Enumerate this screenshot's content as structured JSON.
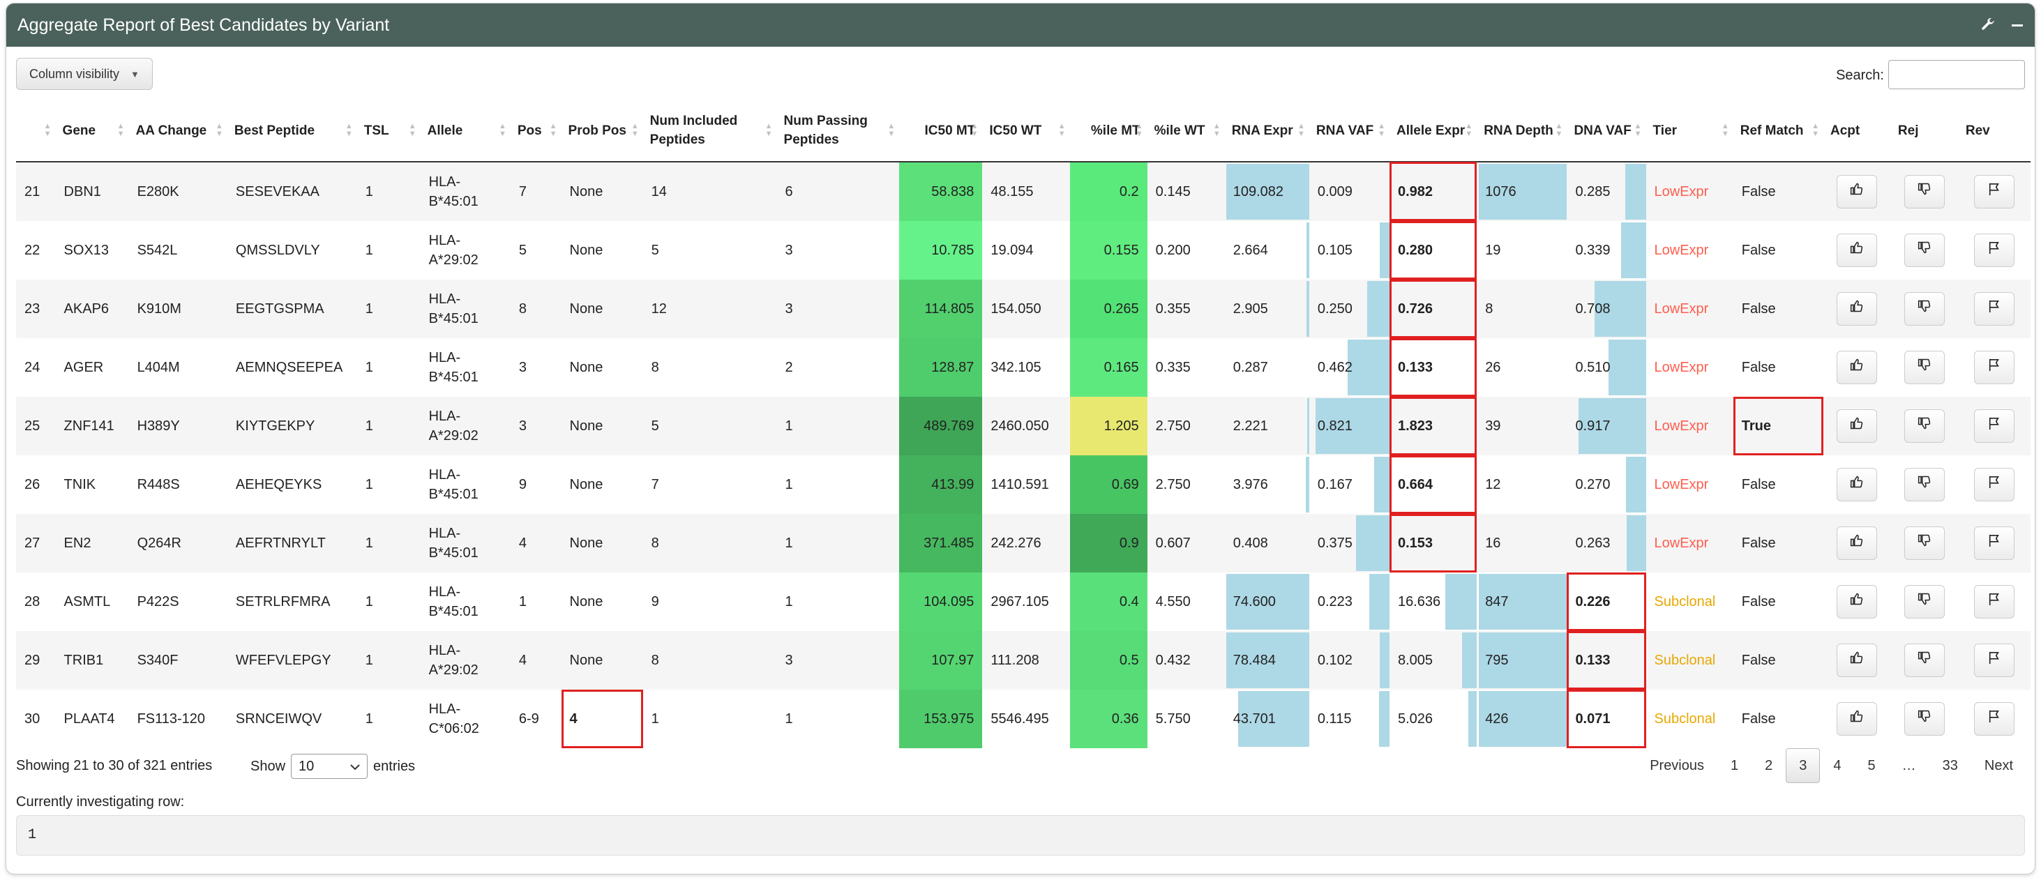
{
  "title": "Aggregate Report of Best Candidates by Variant",
  "toolbar": {
    "column_visibility": "Column visibility",
    "search_label": "Search:"
  },
  "columns": [
    {
      "key": "id",
      "label": ""
    },
    {
      "key": "gene",
      "label": "Gene"
    },
    {
      "key": "aa",
      "label": "AA Change"
    },
    {
      "key": "pep",
      "label": "Best Peptide"
    },
    {
      "key": "tsl",
      "label": "TSL"
    },
    {
      "key": "allele",
      "label": "Allele"
    },
    {
      "key": "pos",
      "label": "Pos"
    },
    {
      "key": "ppos",
      "label": "Prob Pos"
    },
    {
      "key": "ninc",
      "label": "Num Included Peptides"
    },
    {
      "key": "npass",
      "label": "Num Passing Peptides"
    },
    {
      "key": "ic50mt",
      "label": "IC50 MT"
    },
    {
      "key": "ic50wt",
      "label": "IC50 WT"
    },
    {
      "key": "pmt",
      "label": "%ile MT"
    },
    {
      "key": "pwt",
      "label": "%ile WT"
    },
    {
      "key": "rexpr",
      "label": "RNA Expr"
    },
    {
      "key": "rvaf",
      "label": "RNA VAF"
    },
    {
      "key": "aexpr",
      "label": "Allele Expr"
    },
    {
      "key": "rdepth",
      "label": "RNA Depth"
    },
    {
      "key": "dvaf",
      "label": "DNA VAF"
    },
    {
      "key": "tier",
      "label": "Tier"
    },
    {
      "key": "ref",
      "label": "Ref Match"
    },
    {
      "key": "acpt",
      "label": "Acpt"
    },
    {
      "key": "rej",
      "label": "Rej"
    },
    {
      "key": "rev",
      "label": "Rev"
    }
  ],
  "rows": [
    {
      "id": "21",
      "gene": "DBN1",
      "aa": "E280K",
      "pep": "SESEVEKAA",
      "tsl": "1",
      "allele": "HLA-B*45:01",
      "pos": "7",
      "ppos": "None",
      "ninc": "14",
      "npass": "6",
      "ic50mt": "58.838",
      "ic50wt": "48.155",
      "pmt": "0.2",
      "pwt": "0.145",
      "rexpr": "109.082",
      "rvaf": "0.009",
      "aexpr": "0.982",
      "rdepth": "1076",
      "dvaf": "0.285",
      "tier": "LowExpr",
      "ref": "False"
    },
    {
      "id": "22",
      "gene": "SOX13",
      "aa": "S542L",
      "pep": "QMSSLDVLY",
      "tsl": "1",
      "allele": "HLA-A*29:02",
      "pos": "5",
      "ppos": "None",
      "ninc": "5",
      "npass": "3",
      "ic50mt": "10.785",
      "ic50wt": "19.094",
      "pmt": "0.155",
      "pwt": "0.200",
      "rexpr": "2.664",
      "rvaf": "0.105",
      "aexpr": "0.280",
      "rdepth": "19",
      "dvaf": "0.339",
      "tier": "LowExpr",
      "ref": "False"
    },
    {
      "id": "23",
      "gene": "AKAP6",
      "aa": "K910M",
      "pep": "EEGTGSPMA",
      "tsl": "1",
      "allele": "HLA-B*45:01",
      "pos": "8",
      "ppos": "None",
      "ninc": "12",
      "npass": "3",
      "ic50mt": "114.805",
      "ic50wt": "154.050",
      "pmt": "0.265",
      "pwt": "0.355",
      "rexpr": "2.905",
      "rvaf": "0.250",
      "aexpr": "0.726",
      "rdepth": "8",
      "dvaf": "0.708",
      "tier": "LowExpr",
      "ref": "False"
    },
    {
      "id": "24",
      "gene": "AGER",
      "aa": "L404M",
      "pep": "AEMNQSEEPEA",
      "tsl": "1",
      "allele": "HLA-B*45:01",
      "pos": "3",
      "ppos": "None",
      "ninc": "8",
      "npass": "2",
      "ic50mt": "128.87",
      "ic50wt": "342.105",
      "pmt": "0.165",
      "pwt": "0.335",
      "rexpr": "0.287",
      "rvaf": "0.462",
      "aexpr": "0.133",
      "rdepth": "26",
      "dvaf": "0.510",
      "tier": "LowExpr",
      "ref": "False"
    },
    {
      "id": "25",
      "gene": "ZNF141",
      "aa": "H389Y",
      "pep": "KIYTGEKPY",
      "tsl": "1",
      "allele": "HLA-A*29:02",
      "pos": "3",
      "ppos": "None",
      "ninc": "5",
      "npass": "1",
      "ic50mt": "489.769",
      "ic50wt": "2460.050",
      "pmt": "1.205",
      "pwt": "2.750",
      "rexpr": "2.221",
      "rvaf": "0.821",
      "aexpr": "1.823",
      "rdepth": "39",
      "dvaf": "0.917",
      "tier": "LowExpr",
      "ref": "True"
    },
    {
      "id": "26",
      "gene": "TNIK",
      "aa": "R448S",
      "pep": "AEHEQEYKS",
      "tsl": "1",
      "allele": "HLA-B*45:01",
      "pos": "9",
      "ppos": "None",
      "ninc": "7",
      "npass": "1",
      "ic50mt": "413.99",
      "ic50wt": "1410.591",
      "pmt": "0.69",
      "pwt": "2.750",
      "rexpr": "3.976",
      "rvaf": "0.167",
      "aexpr": "0.664",
      "rdepth": "12",
      "dvaf": "0.270",
      "tier": "LowExpr",
      "ref": "False"
    },
    {
      "id": "27",
      "gene": "EN2",
      "aa": "Q264R",
      "pep": "AEFRTNRYLT",
      "tsl": "1",
      "allele": "HLA-B*45:01",
      "pos": "4",
      "ppos": "None",
      "ninc": "8",
      "npass": "1",
      "ic50mt": "371.485",
      "ic50wt": "242.276",
      "pmt": "0.9",
      "pwt": "0.607",
      "rexpr": "0.408",
      "rvaf": "0.375",
      "aexpr": "0.153",
      "rdepth": "16",
      "dvaf": "0.263",
      "tier": "LowExpr",
      "ref": "False"
    },
    {
      "id": "28",
      "gene": "ASMTL",
      "aa": "P422S",
      "pep": "SETRLRFMRA",
      "tsl": "1",
      "allele": "HLA-B*45:01",
      "pos": "1",
      "ppos": "None",
      "ninc": "9",
      "npass": "1",
      "ic50mt": "104.095",
      "ic50wt": "2967.105",
      "pmt": "0.4",
      "pwt": "4.550",
      "rexpr": "74.600",
      "rvaf": "0.223",
      "aexpr": "16.636",
      "rdepth": "847",
      "dvaf": "0.226",
      "tier": "Subclonal",
      "ref": "False"
    },
    {
      "id": "29",
      "gene": "TRIB1",
      "aa": "S340F",
      "pep": "WFEFVLEPGY",
      "tsl": "1",
      "allele": "HLA-A*29:02",
      "pos": "4",
      "ppos": "None",
      "ninc": "8",
      "npass": "3",
      "ic50mt": "107.97",
      "ic50wt": "111.208",
      "pmt": "0.5",
      "pwt": "0.432",
      "rexpr": "78.484",
      "rvaf": "0.102",
      "aexpr": "8.005",
      "rdepth": "795",
      "dvaf": "0.133",
      "tier": "Subclonal",
      "ref": "False"
    },
    {
      "id": "30",
      "gene": "PLAAT4",
      "aa": "FS113-120",
      "pep": "SRNCEIWQV",
      "tsl": "1",
      "allele": "HLA-C*06:02",
      "pos": "6-9",
      "ppos": "4",
      "ninc": "1",
      "npass": "1",
      "ic50mt": "153.975",
      "ic50wt": "5546.495",
      "pmt": "0.36",
      "pwt": "5.750",
      "rexpr": "43.701",
      "rvaf": "0.115",
      "aexpr": "5.026",
      "rdepth": "426",
      "dvaf": "0.071",
      "tier": "Subclonal",
      "ref": "False"
    }
  ],
  "styling": {
    "ic50_colors": [
      "#5ce07a",
      "#66f28a",
      "#52d06e",
      "#4fcd6c",
      "#3ea656",
      "#44b25c",
      "#46b85f",
      "#55d873",
      "#54d571",
      "#4fcb6b"
    ],
    "pct_colors": [
      "#5aea7c",
      "#60ed80",
      "#52e275",
      "#5ee97f",
      "#e8e870",
      "#48c563",
      "#3fa958",
      "#5ae07a",
      "#57dc77",
      "#5ce07b"
    ],
    "rexpr_fill": [
      0.98,
      0.03,
      0.03,
      0.0,
      0.02,
      0.04,
      0.0,
      0.98,
      0.98,
      0.84
    ],
    "rvaf_fill": [
      0.0,
      0.12,
      0.28,
      0.52,
      0.92,
      0.19,
      0.42,
      0.25,
      0.12,
      0.13
    ],
    "aexpr_fill": [
      0.0,
      0.0,
      0.0,
      0.0,
      0.0,
      0.0,
      0.0,
      0.36,
      0.17,
      0.1
    ],
    "rdepth_fill": [
      0.98,
      0.0,
      0.0,
      0.0,
      0.0,
      0.0,
      0.0,
      0.98,
      0.98,
      0.98
    ],
    "dvaf_fill": [
      0.26,
      0.31,
      0.65,
      0.47,
      0.85,
      0.25,
      0.24,
      0.0,
      0.0,
      0.0
    ],
    "highlight_cells": [
      [
        "aexpr",
        0
      ],
      [
        "aexpr",
        1
      ],
      [
        "aexpr",
        2
      ],
      [
        "aexpr",
        3
      ],
      [
        "aexpr",
        4
      ],
      [
        "aexpr",
        5
      ],
      [
        "aexpr",
        6
      ],
      [
        "dvaf",
        7
      ],
      [
        "dvaf",
        8
      ],
      [
        "dvaf",
        9
      ],
      [
        "ref",
        4
      ],
      [
        "ppos",
        9
      ]
    ]
  },
  "footer": {
    "showing": "Showing 21 to 30 of 321 entries",
    "show": "Show",
    "length_value": "10",
    "entries": "entries",
    "pages": [
      "Previous",
      "1",
      "2",
      "3",
      "4",
      "5",
      "…",
      "33",
      "Next"
    ],
    "current_page": "3",
    "investigating_label": "Currently investigating row:",
    "investigating_value": "1"
  }
}
